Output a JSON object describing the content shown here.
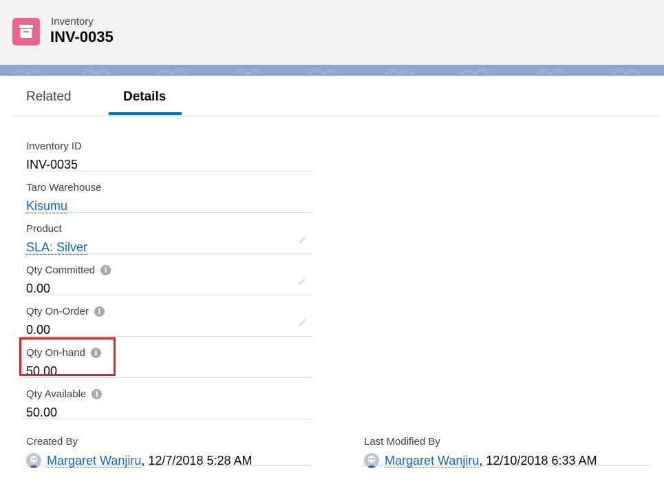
{
  "header": {
    "object_label": "Inventory",
    "record_title": "INV-0035",
    "icon": "archive-box-icon",
    "icon_color": "#e8668a"
  },
  "tabs": [
    {
      "label": "Related",
      "active": false
    },
    {
      "label": "Details",
      "active": true
    }
  ],
  "fields": [
    {
      "label": "Inventory ID",
      "value": "INV-0035",
      "is_link": false,
      "info": false,
      "editable": false
    },
    {
      "label": "Taro Warehouse",
      "value": "Kisumu",
      "is_link": true,
      "info": false,
      "editable": false
    },
    {
      "label": "Product",
      "value": "SLA: Silver",
      "is_link": true,
      "info": false,
      "editable": true
    },
    {
      "label": "Qty Committed",
      "value": "0.00",
      "is_link": false,
      "info": true,
      "editable": true
    },
    {
      "label": "Qty On-Order",
      "value": "0.00",
      "is_link": false,
      "info": true,
      "editable": true
    },
    {
      "label": "Qty On-hand",
      "value": "50.00",
      "is_link": false,
      "info": true,
      "editable": false,
      "highlighted": true
    },
    {
      "label": "Qty Available",
      "value": "50.00",
      "is_link": false,
      "info": true,
      "editable": false
    }
  ],
  "system": {
    "created_by": {
      "label": "Created By",
      "user": "Margaret Wanjiru",
      "datetime": ", 12/7/2018 5:28 AM"
    },
    "modified_by": {
      "label": "Last Modified By",
      "user": "Margaret Wanjiru",
      "datetime": ", 12/10/2018 6:33 AM"
    }
  },
  "info_glyph": "i",
  "colors": {
    "link": "#0a67c4",
    "tab_active": "#0070d2",
    "highlight": "#d9262c"
  }
}
